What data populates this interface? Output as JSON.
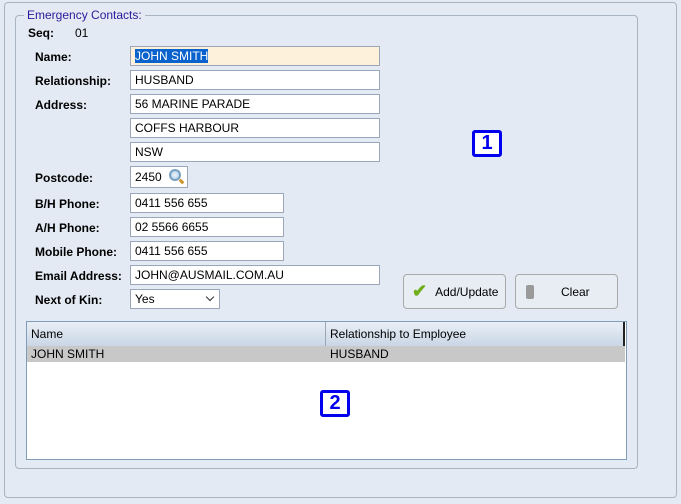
{
  "group_title": "Emergency Contacts:",
  "seq": {
    "label": "Seq:",
    "value": "01"
  },
  "fields": {
    "name": {
      "label": "Name:",
      "value": "JOHN SMITH"
    },
    "relationship": {
      "label": "Relationship:",
      "value": "HUSBAND"
    },
    "address": {
      "label": "Address:",
      "line1": "56 MARINE PARADE",
      "line2": "COFFS HARBOUR",
      "line3": "NSW"
    },
    "postcode": {
      "label": "Postcode:",
      "value": "2450"
    },
    "bh_phone": {
      "label": "B/H Phone:",
      "value": "0411 556 655"
    },
    "ah_phone": {
      "label": "A/H Phone:",
      "value": "02 5566 6655"
    },
    "mobile": {
      "label": "Mobile Phone:",
      "value": "0411 556 655"
    },
    "email": {
      "label": "Email Address:",
      "value": "JOHN@AUSMAIL.COM.AU"
    },
    "next_of_kin": {
      "label": "Next of Kin:",
      "value": "Yes"
    }
  },
  "buttons": {
    "add_update": "Add/Update",
    "clear": "Clear"
  },
  "table": {
    "columns": [
      "Name",
      "Relationship to Employee"
    ],
    "rows": [
      [
        "JOHN SMITH",
        "HUSBAND"
      ]
    ]
  },
  "markers": [
    "1",
    "2"
  ]
}
